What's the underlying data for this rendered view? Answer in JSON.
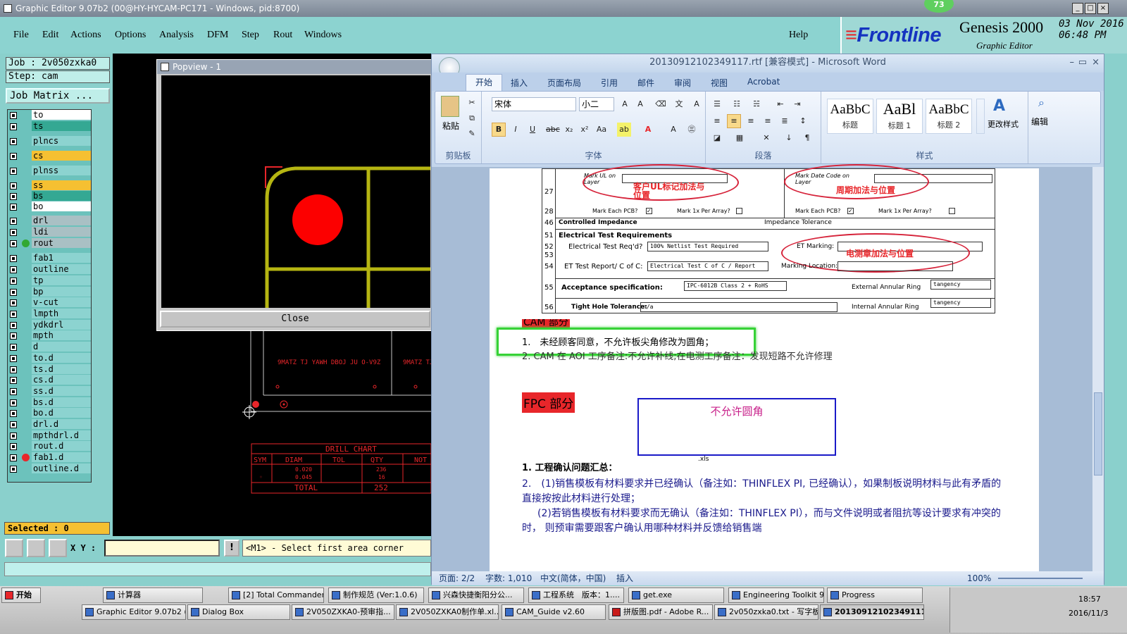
{
  "genesis": {
    "window_title": "Graphic Editor 9.07b2 (00@HY-HYCAM-PC171 - Windows, pid:8700)",
    "menu": [
      "File",
      "Edit",
      "Actions",
      "Options",
      "Analysis",
      "DFM",
      "Step",
      "Rout",
      "Windows"
    ],
    "help": "Help",
    "badge": "73",
    "logo": "Frontline",
    "product": "Genesis 2000",
    "subtitle": "Graphic Editor",
    "date": "03 Nov 2016",
    "time": "06:48 PM",
    "job": "Job : 2v050zxka0",
    "step": "Step: cam",
    "job_matrix": "Job Matrix ...",
    "selected": "Selected : 0",
    "xy_label": "X Y :",
    "prompt": "<M1> - Select first area corner",
    "popview_title": "Popview - 1",
    "close": "Close",
    "layers": [
      {
        "name": "to",
        "color": "#ffffff"
      },
      {
        "name": "ts",
        "color": "#34a893"
      },
      {
        "name": "plncs",
        "color": "#8cd3d0"
      },
      {
        "name": "cs",
        "color": "#f5c032"
      },
      {
        "name": "plnss",
        "color": "#8cd3d0"
      },
      {
        "name": "ss",
        "color": "#f5c032"
      },
      {
        "name": "bs",
        "color": "#34a893"
      },
      {
        "name": "bo",
        "color": "#ffffff"
      },
      {
        "name": "drl",
        "color": "#a9c0c4"
      },
      {
        "name": "ldi",
        "color": "#a9c0c4"
      },
      {
        "name": "rout",
        "color": "#a9c0c4"
      },
      {
        "name": "fab1",
        "color": "#8cd3d0"
      },
      {
        "name": "outline",
        "color": "#8cd3d0"
      },
      {
        "name": "tp",
        "color": "#8cd3d0"
      },
      {
        "name": "bp",
        "color": "#8cd3d0"
      },
      {
        "name": "v-cut",
        "color": "#8cd3d0"
      },
      {
        "name": "lmpth",
        "color": "#8cd3d0"
      },
      {
        "name": "ydkdrl",
        "color": "#8cd3d0"
      },
      {
        "name": "mpth",
        "color": "#8cd3d0"
      },
      {
        "name": "d",
        "color": "#8cd3d0"
      },
      {
        "name": "to.d",
        "color": "#8cd3d0"
      },
      {
        "name": "ts.d",
        "color": "#8cd3d0"
      },
      {
        "name": "cs.d",
        "color": "#8cd3d0"
      },
      {
        "name": "ss.d",
        "color": "#8cd3d0"
      },
      {
        "name": "bs.d",
        "color": "#8cd3d0"
      },
      {
        "name": "bo.d",
        "color": "#8cd3d0"
      },
      {
        "name": "drl.d",
        "color": "#8cd3d0"
      },
      {
        "name": "mpthdrl.d",
        "color": "#8cd3d0"
      },
      {
        "name": "rout.d",
        "color": "#8cd3d0"
      },
      {
        "name": "fab1.d",
        "color": "#8cd3d0"
      },
      {
        "name": "outline.d",
        "color": "#8cd3d0"
      }
    ],
    "canvas_text": "9MATZ TJ YAWH DBOJ JU O-V9Z",
    "canvas_text2": "9MATZ TJ",
    "drill_chart": {
      "title": "DRILL  CHART",
      "headers": [
        "SYM",
        "DIAM",
        "TOL",
        "QTY",
        "NOT"
      ],
      "rows": [
        [
          "",
          "0.020",
          "",
          "236",
          ""
        ],
        [
          "◦",
          "0.045",
          "",
          "16",
          ""
        ]
      ],
      "total_label": "TOTAL",
      "total": "252"
    }
  },
  "word": {
    "title": "20130912102349117.rtf [兼容模式] - Microsoft Word",
    "tabs": [
      "开始",
      "插入",
      "页面布局",
      "引用",
      "邮件",
      "审阅",
      "视图",
      "Acrobat"
    ],
    "groups": {
      "clipboard": "剪贴板",
      "font": "字体",
      "paragraph": "段落",
      "styles": "样式",
      "edit": "编辑"
    },
    "paste": "粘贴",
    "font_name": "宋体",
    "font_size": "小二",
    "styles": [
      {
        "sample": "AaBbC",
        "name": "标题"
      },
      {
        "sample": "AaBl",
        "name": "标题 1"
      },
      {
        "sample": "AaBbC",
        "name": "标题 2"
      }
    ],
    "change_styles": "更改样式",
    "form": {
      "r27": "27",
      "r28": "28",
      "r46": "46",
      "r51": "51",
      "r52": "52",
      "r53": "53",
      "r54": "54",
      "r55": "55",
      "r56": "56",
      "mark_ul": "Mark UL on Layer",
      "mark_date": "Mark Date Code on Layer",
      "ann_ul": "客户UL标记加法与位置",
      "ann_date": "周期加法与位置",
      "mark_each": "Mark Each PCB?",
      "mark_1x": "Mark 1x Per Array?",
      "controlled": "Controlled Impedance",
      "imp_tol": "Impedance Tolerance",
      "et_req": "Electrical Test Requirements",
      "et_reqd": "Electrical Test Req'd?",
      "et_val": "100% Netlist Test Required",
      "et_marking": "ET Marking:",
      "ann_et": "电测章加法与位置",
      "et_report": "ET Test Report/ C of C:",
      "et_report_val": "Electrical Test C of C / Report",
      "mark_loc": "Marking Location:",
      "accept": "Acceptance specification:",
      "accept_val": "IPC-6012B Class 2 + RoHS",
      "ext_ring": "External Annular Ring",
      "ext_val": "tangency",
      "tight": "Tight Hole Tolerance:",
      "tight_val": "n/a",
      "int_ring": "Internal Annular Ring",
      "int_val": "tangency"
    },
    "cam_head": "CAM 部分",
    "item1": "1.　未经顾客同意，不允许板尖角修改为圆角；",
    "item2": "2. CAM 在 AOI 工序备注:不允许补线;在电测工序备注：发现短路不允许修理",
    "fpc_head": "FPC 部分",
    "box_text": "不允许圆角",
    "xls": ".xls",
    "sec1": "1. 工程确认问题汇总：",
    "p2": "2.　(1)销售模板有材料要求并已经确认（备注如：THINFLEX PI, 已经确认），如果制板说明材料与此有矛盾的直接按按此材料进行处理；",
    "p3": "(2)若销售模板有材料要求而无确认（备注如：THINFLEX PI），而与文件说明或者阻抗等设计要求有冲突的时， 则预审需要跟客户确认用哪种材料并反馈给销售端",
    "status": {
      "page": "页面: 2/2",
      "words": "字数: 1,010",
      "lang": "中文(简体，中国)",
      "mode": "插入",
      "zoom": "100%"
    }
  },
  "taskbar": {
    "start": "开始",
    "row1": [
      "计算器",
      "[2] Total Commander...",
      "制作规范 (Ver:1.0.6)",
      "兴森快捷衡阳分公...",
      "工程系统　版本：1....",
      "get.exe",
      "Engineering Toolkit 9....",
      "Progress"
    ],
    "row2": [
      "Graphic Editor 9.07b2 (...",
      "Dialog Box",
      "2V050ZXKA0-预审指...",
      "2V050ZXKA0制作单.xl...",
      "CAM_Guide v2.60",
      "拼版图.pdf - Adobe R...",
      "2v050zxka0.txt - 写字板",
      "20130912102349111..."
    ],
    "clock_time": "18:57",
    "clock_date": "2016/11/3"
  }
}
